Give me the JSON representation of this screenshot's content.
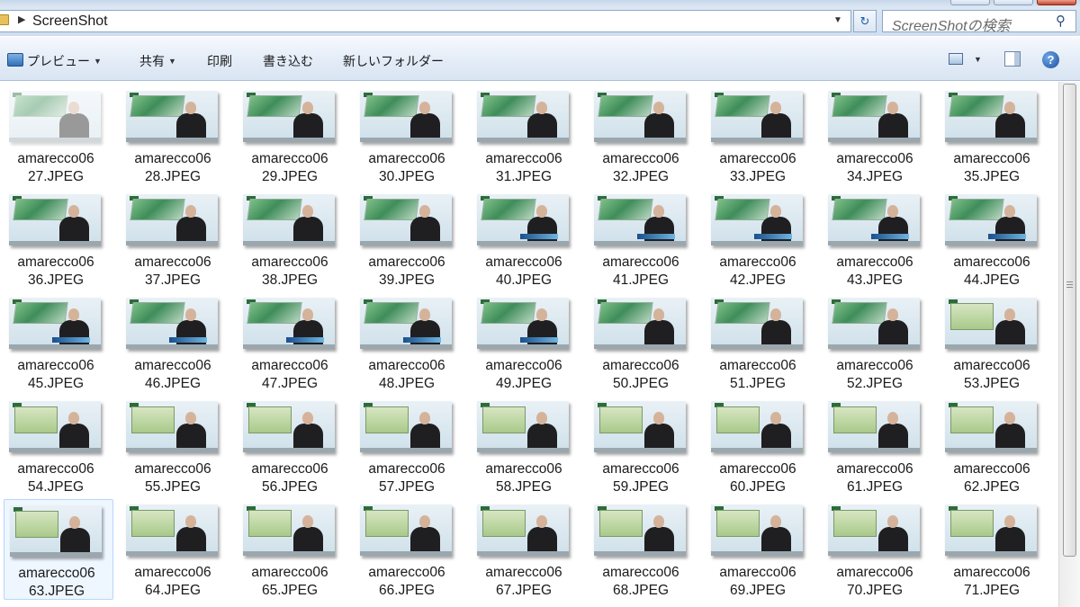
{
  "window": {
    "title": "ScreenShot"
  },
  "address_bar": {
    "path": "ScreenShot"
  },
  "search": {
    "placeholder": "ScreenShotの検索"
  },
  "command_bar": {
    "preview": "プレビュー",
    "share": "共有",
    "print": "印刷",
    "burn": "書き込む",
    "new_folder": "新しいフォルダー"
  },
  "files": [
    {
      "name_line1": "amarecco06",
      "name_line2": "27.JPEG"
    },
    {
      "name_line1": "amarecco06",
      "name_line2": "28.JPEG"
    },
    {
      "name_line1": "amarecco06",
      "name_line2": "29.JPEG"
    },
    {
      "name_line1": "amarecco06",
      "name_line2": "30.JPEG"
    },
    {
      "name_line1": "amarecco06",
      "name_line2": "31.JPEG"
    },
    {
      "name_line1": "amarecco06",
      "name_line2": "32.JPEG"
    },
    {
      "name_line1": "amarecco06",
      "name_line2": "33.JPEG"
    },
    {
      "name_line1": "amarecco06",
      "name_line2": "34.JPEG"
    },
    {
      "name_line1": "amarecco06",
      "name_line2": "35.JPEG"
    },
    {
      "name_line1": "amarecco06",
      "name_line2": "36.JPEG"
    },
    {
      "name_line1": "amarecco06",
      "name_line2": "37.JPEG"
    },
    {
      "name_line1": "amarecco06",
      "name_line2": "38.JPEG"
    },
    {
      "name_line1": "amarecco06",
      "name_line2": "39.JPEG"
    },
    {
      "name_line1": "amarecco06",
      "name_line2": "40.JPEG"
    },
    {
      "name_line1": "amarecco06",
      "name_line2": "41.JPEG"
    },
    {
      "name_line1": "amarecco06",
      "name_line2": "42.JPEG"
    },
    {
      "name_line1": "amarecco06",
      "name_line2": "43.JPEG"
    },
    {
      "name_line1": "amarecco06",
      "name_line2": "44.JPEG"
    },
    {
      "name_line1": "amarecco06",
      "name_line2": "45.JPEG"
    },
    {
      "name_line1": "amarecco06",
      "name_line2": "46.JPEG"
    },
    {
      "name_line1": "amarecco06",
      "name_line2": "47.JPEG"
    },
    {
      "name_line1": "amarecco06",
      "name_line2": "48.JPEG"
    },
    {
      "name_line1": "amarecco06",
      "name_line2": "49.JPEG"
    },
    {
      "name_line1": "amarecco06",
      "name_line2": "50.JPEG"
    },
    {
      "name_line1": "amarecco06",
      "name_line2": "51.JPEG"
    },
    {
      "name_line1": "amarecco06",
      "name_line2": "52.JPEG"
    },
    {
      "name_line1": "amarecco06",
      "name_line2": "53.JPEG"
    },
    {
      "name_line1": "amarecco06",
      "name_line2": "54.JPEG"
    },
    {
      "name_line1": "amarecco06",
      "name_line2": "55.JPEG"
    },
    {
      "name_line1": "amarecco06",
      "name_line2": "56.JPEG"
    },
    {
      "name_line1": "amarecco06",
      "name_line2": "57.JPEG"
    },
    {
      "name_line1": "amarecco06",
      "name_line2": "58.JPEG"
    },
    {
      "name_line1": "amarecco06",
      "name_line2": "59.JPEG"
    },
    {
      "name_line1": "amarecco06",
      "name_line2": "60.JPEG"
    },
    {
      "name_line1": "amarecco06",
      "name_line2": "61.JPEG"
    },
    {
      "name_line1": "amarecco06",
      "name_line2": "62.JPEG"
    },
    {
      "name_line1": "amarecco06",
      "name_line2": "63.JPEG"
    },
    {
      "name_line1": "amarecco06",
      "name_line2": "64.JPEG"
    },
    {
      "name_line1": "amarecco06",
      "name_line2": "65.JPEG"
    },
    {
      "name_line1": "amarecco06",
      "name_line2": "66.JPEG"
    },
    {
      "name_line1": "amarecco06",
      "name_line2": "67.JPEG"
    },
    {
      "name_line1": "amarecco06",
      "name_line2": "68.JPEG"
    },
    {
      "name_line1": "amarecco06",
      "name_line2": "69.JPEG"
    },
    {
      "name_line1": "amarecco06",
      "name_line2": "70.JPEG"
    },
    {
      "name_line1": "amarecco06",
      "name_line2": "71.JPEG"
    }
  ]
}
